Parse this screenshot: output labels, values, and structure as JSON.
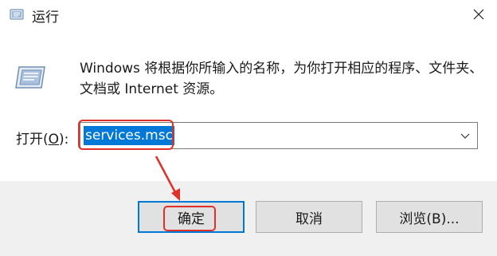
{
  "window": {
    "title": "运行",
    "icon": "run-dialog-icon",
    "close_icon": "close-icon"
  },
  "content": {
    "description": "Windows 将根据你所输入的名称，为你打开相应的程序、文件夹、文档或 Internet 资源。",
    "open_label_prefix": "打开(",
    "open_label_access": "O",
    "open_label_suffix": "):",
    "input_value": "services.msc",
    "dropdown_icon": "chevron-down-icon"
  },
  "buttons": {
    "ok": "确定",
    "cancel": "取消",
    "browse": "浏览(B)..."
  },
  "annotations": {
    "highlight_color": "#e0302a",
    "selection_color": "#0078d7"
  }
}
